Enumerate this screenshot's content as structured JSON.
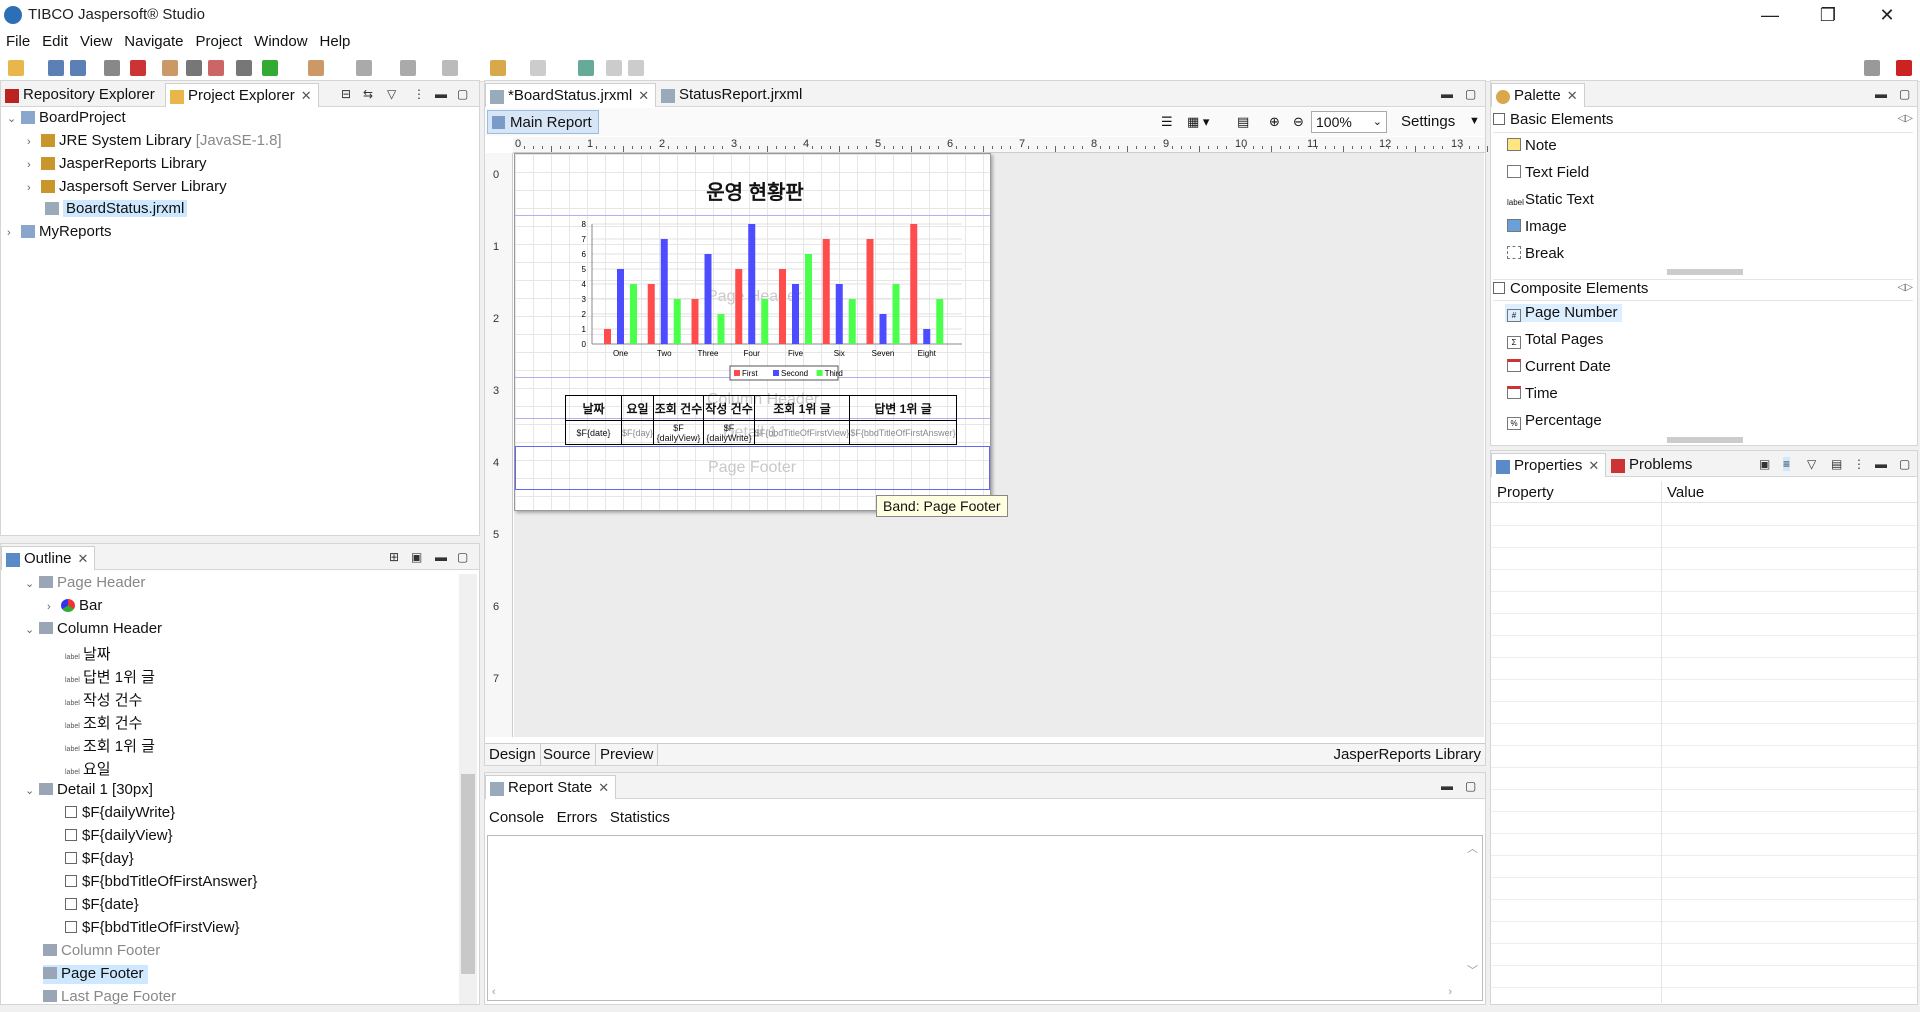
{
  "window": {
    "title": "TIBCO Jaspersoft® Studio"
  },
  "menu": [
    "File",
    "Edit",
    "View",
    "Navigate",
    "Project",
    "Window",
    "Help"
  ],
  "explorer": {
    "tabs": [
      {
        "label": "Repository Explorer"
      },
      {
        "label": "Project Explorer"
      }
    ],
    "tree": {
      "project": "BoardProject",
      "children": [
        {
          "label": "JRE System Library",
          "suffix": "[JavaSE-1.8]"
        },
        {
          "label": "JasperReports Library"
        },
        {
          "label": "Jaspersoft Server Library"
        },
        {
          "label": "BoardStatus.jrxml"
        }
      ],
      "other": "MyReports"
    }
  },
  "outline": {
    "tab": "Outline",
    "items": {
      "page_header": "Page Header",
      "bar": "Bar",
      "column_header": "Column Header",
      "labels": [
        "날짜",
        "답변 1위 글",
        "작성 건수",
        "조회 건수",
        "조회 1위 글",
        "요일"
      ],
      "detail": "Detail 1 [30px]",
      "fields": [
        "$F{dailyWrite}",
        "$F{dailyView}",
        "$F{day}",
        "$F{bbdTitleOfFirstAnswer}",
        "$F{date}",
        "$F{bbdTitleOfFirstView}"
      ],
      "column_footer": "Column Footer",
      "page_footer": "Page Footer",
      "last_page_footer": "Last Page Footer"
    },
    "label_icon_text": "label"
  },
  "editor": {
    "tabs": [
      {
        "label": "*BoardStatus.jrxml"
      },
      {
        "label": "StatusReport.jrxml"
      }
    ],
    "subtab": "Main Report",
    "zoom": "100%",
    "settings": "Settings",
    "ruler_h": [
      "0",
      "1",
      "2",
      "3",
      "4",
      "5",
      "6",
      "7",
      "8",
      "9",
      "10",
      "11",
      "12",
      "13"
    ],
    "ruler_v": [
      "0",
      "1",
      "2",
      "3",
      "4",
      "5",
      "6",
      "7"
    ],
    "report_title": "운영 현황판",
    "watermarks": {
      "page_header": "Page Header",
      "column_header": "Column Header",
      "detail": "Detail 1",
      "page_footer": "Page Footer"
    },
    "table_headers": [
      "날짜",
      "요일",
      "조회 건수",
      "작성 건수",
      "조회 1위 글",
      "답변 1위 글"
    ],
    "table_fields": [
      "$F{date}",
      "$F{day}",
      "$F\n{dailyView}",
      "$F\n{dailyWrite}",
      "$F{bbdTitleOfFirstView}",
      "$F{bbdTitleOfFirstAnswer}"
    ],
    "tooltip": "Band: Page Footer",
    "bottom_tabs": [
      "Design",
      "Source",
      "Preview"
    ],
    "library": "JasperReports Library"
  },
  "chart_data": {
    "type": "bar",
    "categories": [
      "One",
      "Two",
      "Three",
      "Four",
      "Five",
      "Six",
      "Seven",
      "Eight"
    ],
    "series": [
      {
        "name": "First",
        "color": "#ff4d4d",
        "values": [
          1,
          4,
          3,
          5,
          5,
          7,
          7,
          8
        ]
      },
      {
        "name": "Second",
        "color": "#4d4dff",
        "values": [
          5,
          7,
          6,
          8,
          4,
          4,
          2,
          1
        ]
      },
      {
        "name": "Third",
        "color": "#4dff4d",
        "values": [
          4,
          3,
          2,
          3,
          6,
          3,
          4,
          3
        ]
      }
    ],
    "ylim": [
      0,
      8
    ],
    "yticks": [
      "0",
      "1",
      "2",
      "3",
      "4",
      "5",
      "6",
      "7",
      "8"
    ],
    "legend": "bottom"
  },
  "report_state": {
    "tab": "Report State",
    "subtabs": [
      "Console",
      "Errors",
      "Statistics"
    ]
  },
  "palette": {
    "tab": "Palette",
    "basic": {
      "title": "Basic Elements",
      "items": [
        "Note",
        "Text Field",
        "Static Text",
        "Image",
        "Break"
      ]
    },
    "composite": {
      "title": "Composite Elements",
      "items": [
        "Page Number",
        "Total Pages",
        "Current Date",
        "Time",
        "Percentage"
      ]
    }
  },
  "properties": {
    "tabs": [
      {
        "label": "Properties"
      },
      {
        "label": "Problems"
      }
    ],
    "columns": [
      "Property",
      "Value"
    ]
  }
}
